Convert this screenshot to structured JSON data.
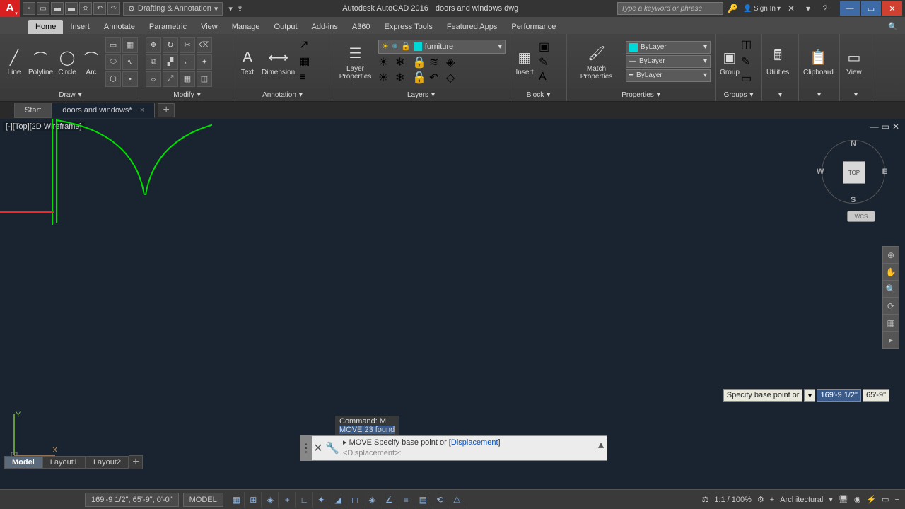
{
  "title": {
    "app": "Autodesk AutoCAD 2016",
    "file": "doors and windows.dwg",
    "workspace": "Drafting & Annotation",
    "search_placeholder": "Type a keyword or phrase",
    "signin": "Sign In"
  },
  "ribbon": {
    "tabs": [
      "Home",
      "Insert",
      "Annotate",
      "Parametric",
      "View",
      "Manage",
      "Output",
      "Add-ins",
      "A360",
      "Express Tools",
      "Featured Apps",
      "Performance"
    ],
    "active_tab": "Home",
    "panels": {
      "draw": {
        "title": "Draw",
        "items": [
          "Line",
          "Polyline",
          "Circle",
          "Arc"
        ]
      },
      "modify": {
        "title": "Modify"
      },
      "annotation": {
        "title": "Annotation",
        "items": [
          "Text",
          "Dimension"
        ]
      },
      "layers": {
        "title": "Layers",
        "prop_btn": "Layer Properties",
        "current": "furniture",
        "swatch": "#00d8d8"
      },
      "block": {
        "title": "Block",
        "items": [
          "Insert"
        ],
        "match": "Match Properties"
      },
      "properties": {
        "title": "Properties",
        "rows": [
          "ByLayer",
          "ByLayer",
          "ByLayer"
        ],
        "swatch": "#00d8d8"
      },
      "groups": {
        "title": "Groups",
        "item": "Group"
      },
      "utilities": {
        "title": "Utilities"
      },
      "clipboard": {
        "title": "Clipboard"
      },
      "view": {
        "title": "View"
      }
    }
  },
  "filetabs": {
    "start": "Start",
    "active": "doors and windows*",
    "close": "×",
    "add": "+"
  },
  "viewport": {
    "label": "[-][Top][2D Wireframe]",
    "cube": "TOP",
    "compass": {
      "n": "N",
      "s": "S",
      "e": "E",
      "w": "W"
    },
    "wcs": "WCS"
  },
  "ucs": {
    "x": "X",
    "y": "Y"
  },
  "command": {
    "history1": "Command: M",
    "history2_a": "MOVE",
    "history2_b": " 23 found",
    "line1_pre": "MOVE Specify base point or [",
    "line1_link": "Displacement",
    "line1_post": "]",
    "line2": "<Displacement>:"
  },
  "dyninput": {
    "label": "Specify base point or",
    "val1": "169'-9 1/2\"",
    "val2": "65'-9\""
  },
  "layouts": {
    "model": "Model",
    "l1": "Layout1",
    "l2": "Layout2",
    "add": "+"
  },
  "status": {
    "coords": "169'-9 1/2\", 65'-9\", 0'-0\"",
    "space": "MODEL",
    "scale": "1:1 / 100%",
    "units": "Architectural"
  }
}
